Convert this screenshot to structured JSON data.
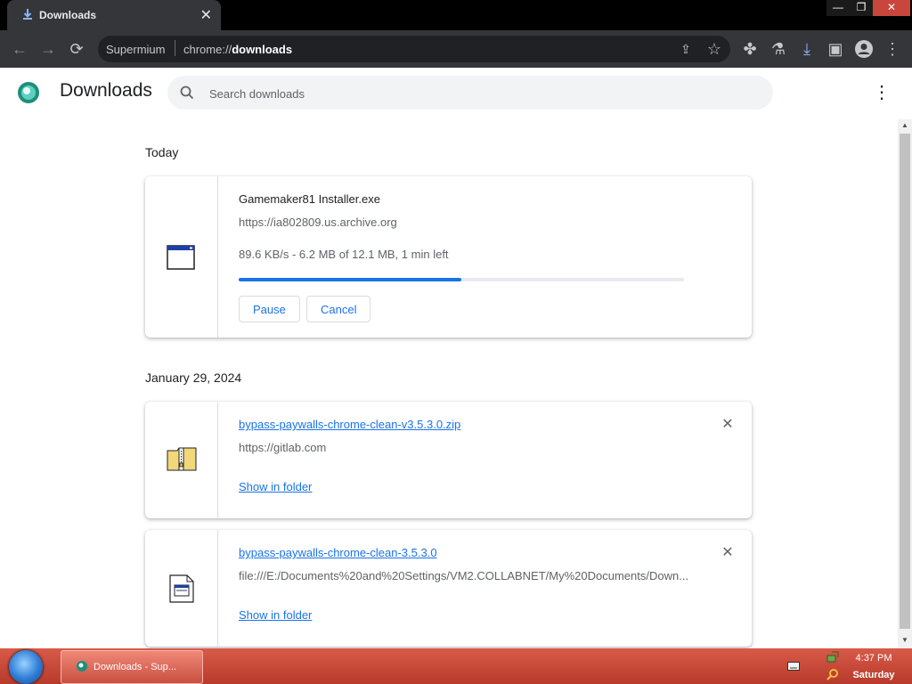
{
  "window": {
    "tab_title": "Downloads",
    "min_glyph": "—",
    "max_glyph": "❐",
    "close_glyph": "✕"
  },
  "toolbar": {
    "site_label": "Supermium",
    "url_prefix": "chrome://",
    "url_host": "downloads"
  },
  "page": {
    "title": "Downloads",
    "search_placeholder": "Search downloads"
  },
  "sections": [
    {
      "date": "Today",
      "items": [
        {
          "filename": "Gamemaker81 Installer.exe",
          "url": "https://ia802809.us.archive.org",
          "status": "89.6 KB/s - 6.2 MB of 12.1 MB, 1 min left",
          "progress_percent": 50,
          "pause_label": "Pause",
          "cancel_label": "Cancel"
        }
      ]
    },
    {
      "date": "January 29, 2024",
      "items": [
        {
          "filename": "bypass-paywalls-chrome-clean-v3.5.3.0.zip",
          "url": "https://gitlab.com",
          "show_folder_label": "Show in folder"
        },
        {
          "filename": "bypass-paywalls-chrome-clean-3.5.3.0",
          "url": "file:///E:/Documents%20and%20Settings/VM2.COLLABNET/My%20Documents/Down...",
          "show_folder_label": "Show in folder"
        }
      ]
    }
  ],
  "taskbar": {
    "task_label": "Downloads - Sup...",
    "time": "4:37 PM",
    "day": "Saturday"
  },
  "colors": {
    "accent": "#1a73e8",
    "toolbar_bg": "#35363a",
    "taskbar": "#c84a3a"
  }
}
